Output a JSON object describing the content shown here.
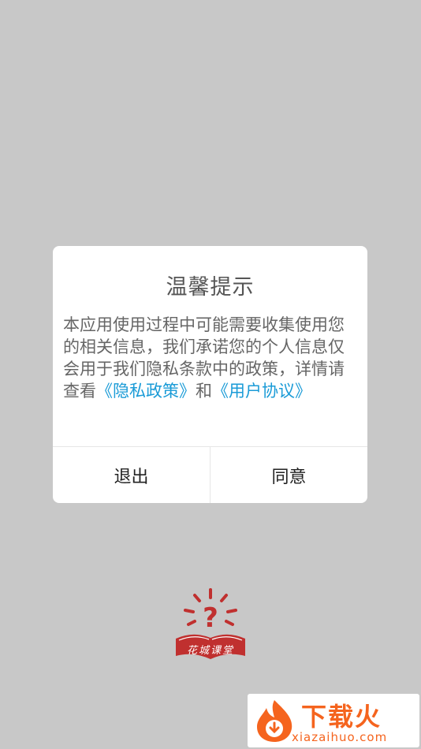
{
  "dialog": {
    "title": "温馨提示",
    "body_text": "本应用使用过程中可能需要收集使用您的相关信息，我们承诺您的个人信息仅会用于我们隐私条款中的政策，详情请查看",
    "privacy_link": "《隐私政策》",
    "connector": "和",
    "agreement_link": "《用户协议》",
    "exit_label": "退出",
    "agree_label": "同意"
  },
  "logo": {
    "text": "花城课堂",
    "icon": "question-lightbulb-book-icon"
  },
  "watermark": {
    "title": "下载火",
    "url": "xiazaihuo.com",
    "icon": "flame-download-icon"
  },
  "colors": {
    "background": "#c8c8c8",
    "link": "#1a9bd7",
    "logo_red": "#c0302f",
    "watermark_orange": "#f5641e"
  }
}
